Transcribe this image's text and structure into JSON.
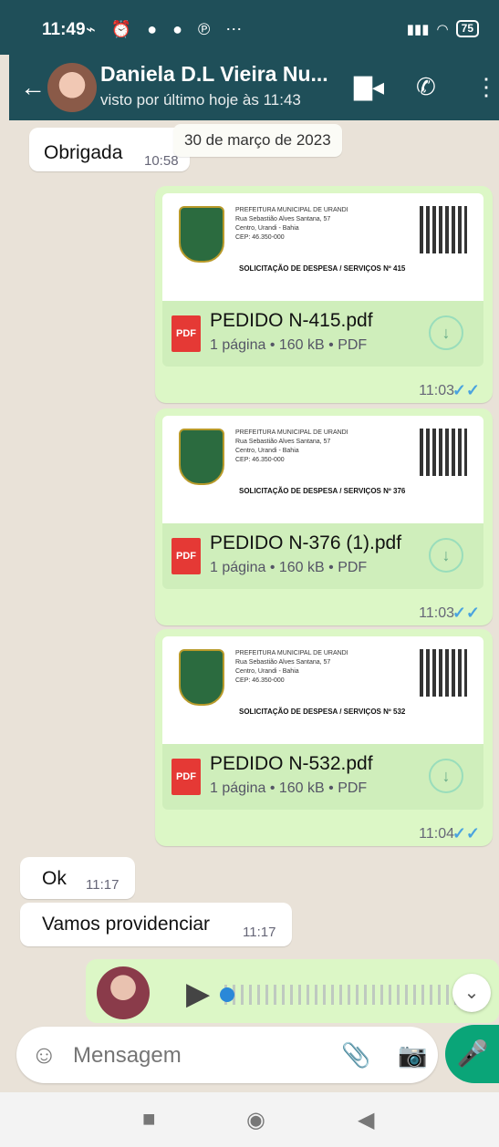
{
  "statusbar": {
    "time": "11:49",
    "left_icons": "⌁ ⏰ ● ● ℗ ⋯",
    "battery": "75"
  },
  "header": {
    "contact_name": "Daniela D.L Vieira Nu...",
    "last_seen": "visto por último hoje às 11:43"
  },
  "chat": {
    "date_chip": "30 de março de 2023",
    "incoming_1": {
      "text": "Obrigada",
      "time": "10:58"
    },
    "documents": [
      {
        "preview_title": "SOLICITAÇÃO DE DESPESA / SERVIÇOS Nº 415",
        "file_name": "PEDIDO N-415.pdf",
        "meta": "1 página • 160 kB • PDF",
        "time": "11:03"
      },
      {
        "preview_title": "SOLICITAÇÃO DE DESPESA / SERVIÇOS Nº 376",
        "file_name": "PEDIDO N-376 (1).pdf",
        "meta": "1 página • 160 kB • PDF",
        "time": "11:03"
      },
      {
        "preview_title": "SOLICITAÇÃO DE DESPESA / SERVIÇOS Nº 532",
        "file_name": "PEDIDO N-532.pdf",
        "meta": "1 página • 160 kB • PDF",
        "time": "11:04"
      }
    ],
    "preview_header": "PREFEITURA MUNICIPAL DE URANDI\nRua Sebastião Alves Santana, 57\nCentro, Urandi - Bahia\nCEP: 46.350-000",
    "incoming_2": {
      "text": "Ok",
      "time": "11:17"
    },
    "incoming_3": {
      "text": "Vamos providenciar",
      "time": "11:17"
    },
    "read_ticks": "✓✓",
    "pdf_badge": "PDF"
  },
  "composer": {
    "placeholder": "Mensagem"
  }
}
